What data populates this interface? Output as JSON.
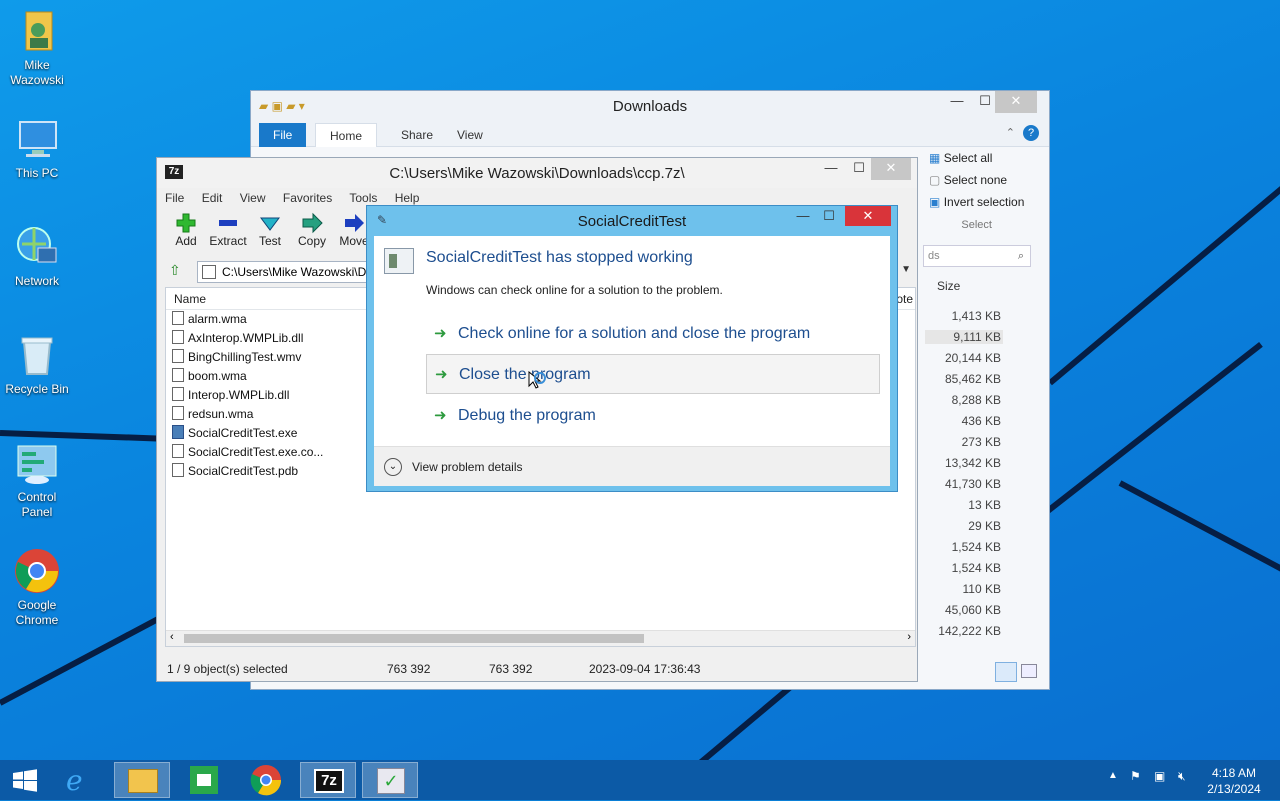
{
  "desktop_icons": [
    {
      "label": "Mike\nWazowski",
      "icon": "user-folder-icon"
    },
    {
      "label": "This PC",
      "icon": "computer-icon"
    },
    {
      "label": "Network",
      "icon": "network-icon"
    },
    {
      "label": "Recycle Bin",
      "icon": "recycle-bin-icon"
    },
    {
      "label": "Control\nPanel",
      "icon": "control-panel-icon"
    },
    {
      "label": "Google\nChrome",
      "icon": "chrome-icon"
    }
  ],
  "explorer": {
    "title": "Downloads",
    "tabs": {
      "file": "File",
      "home": "Home",
      "share": "Share",
      "view": "View"
    },
    "select_all": "Select all",
    "select_none": "Select none",
    "invert_selection": "Invert selection",
    "select_group": "Select",
    "search_placeholder": "ds",
    "size_header": "Size",
    "sizes": [
      "1,413 KB",
      "9,111 KB",
      "20,144 KB",
      "85,462 KB",
      "8,288 KB",
      "436 KB",
      "273 KB",
      "13,342 KB",
      "41,730 KB",
      "13 KB",
      "29 KB",
      "1,524 KB",
      "1,524 KB",
      "110 KB",
      "45,060 KB",
      "142,222 KB"
    ]
  },
  "zip": {
    "title": "C:\\Users\\Mike Wazowski\\Downloads\\ccp.7z\\",
    "menu": {
      "file": "File",
      "edit": "Edit",
      "view": "View",
      "favorites": "Favorites",
      "tools": "Tools",
      "help": "Help"
    },
    "toolbar": {
      "add": "Add",
      "extract": "Extract",
      "test": "Test",
      "copy": "Copy",
      "move": "Move"
    },
    "address": "C:\\Users\\Mike Wazowski\\Do",
    "col_name": "Name",
    "col_other": "ote",
    "files": [
      "alarm.wma",
      "AxInterop.WMPLib.dll",
      "BingChillingTest.wmv",
      "boom.wma",
      "Interop.WMPLib.dll",
      "redsun.wma",
      "SocialCreditTest.exe",
      "SocialCreditTest.exe.co...",
      "SocialCreditTest.pdb"
    ],
    "status": {
      "selected": "1 / 9 object(s) selected",
      "size": "763 392",
      "packed": "763 392",
      "modified": "2023-09-04 17:36:43"
    }
  },
  "dialog": {
    "title": "SocialCreditTest",
    "heading": "SocialCreditTest has stopped working",
    "message": "Windows can check online for a solution to the problem.",
    "option_check": "Check online for a solution and close the program",
    "option_close": "Close the program",
    "option_debug": "Debug the program",
    "details": "View problem details"
  },
  "taskbar": {
    "time": "4:18 AM",
    "date": "2/13/2024",
    "zip_label": "7z"
  }
}
